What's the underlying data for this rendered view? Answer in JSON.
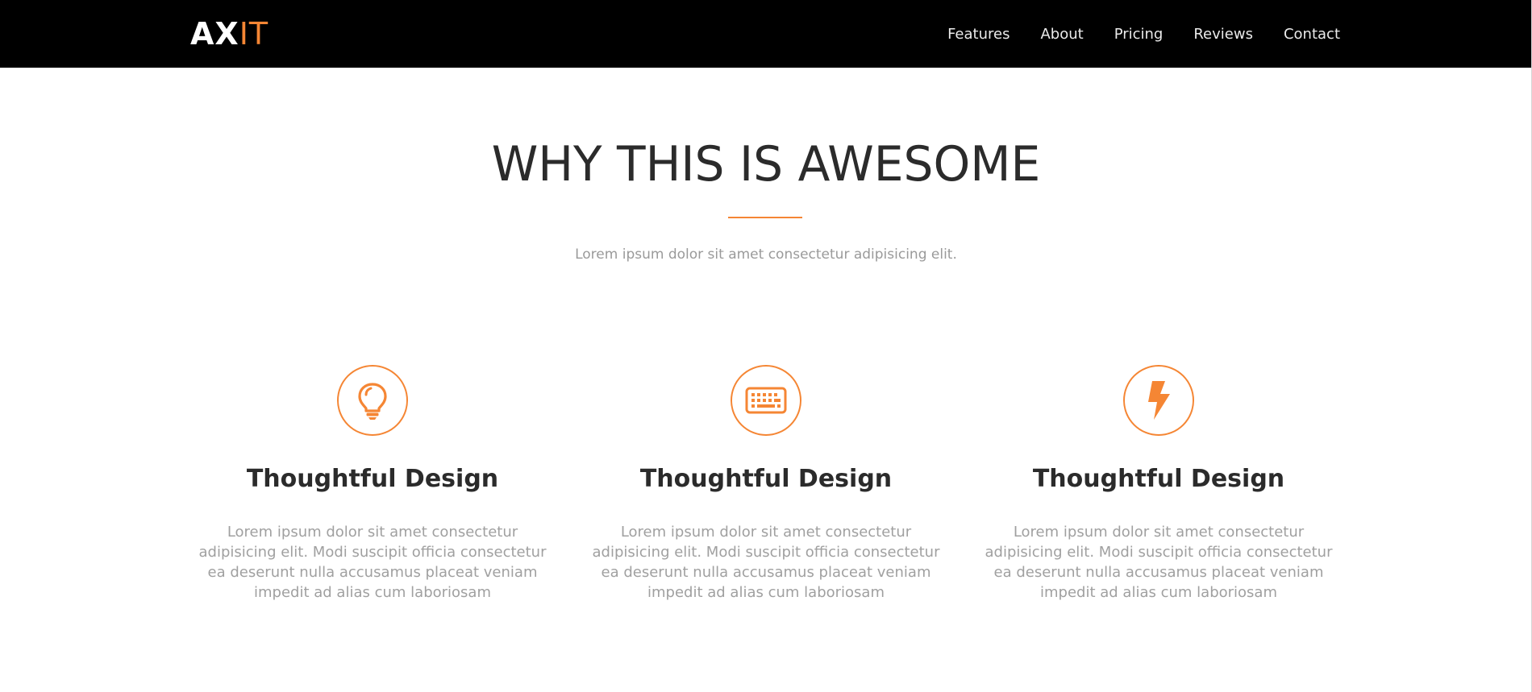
{
  "colors": {
    "accent": "#f58634",
    "navbar_bg": "#000000",
    "heading": "#2b2b2b",
    "muted_text": "#9a9a9a"
  },
  "brand": {
    "part1": "AX",
    "part2": "IT"
  },
  "nav": {
    "items": [
      {
        "label": "Features"
      },
      {
        "label": "About"
      },
      {
        "label": "Pricing"
      },
      {
        "label": "Reviews"
      },
      {
        "label": "Contact"
      }
    ]
  },
  "section": {
    "title": "WHY THIS IS AWESOME",
    "subtitle": "Lorem ipsum dolor sit amet consectetur adipisicing elit."
  },
  "features": [
    {
      "icon": "lightbulb-icon",
      "title": "Thoughtful Design",
      "text": "Lorem ipsum dolor sit amet consectetur adipisicing elit. Modi suscipit officia consectetur ea deserunt nulla accusamus placeat veniam impedit ad alias cum laboriosam"
    },
    {
      "icon": "keyboard-icon",
      "title": "Thoughtful Design",
      "text": "Lorem ipsum dolor sit amet consectetur adipisicing elit. Modi suscipit officia consectetur ea deserunt nulla accusamus placeat veniam impedit ad alias cum laboriosam"
    },
    {
      "icon": "lightning-bolt-icon",
      "title": "Thoughtful Design",
      "text": "Lorem ipsum dolor sit amet consectetur adipisicing elit. Modi suscipit officia consectetur ea deserunt nulla accusamus placeat veniam impedit ad alias cum laboriosam"
    }
  ]
}
